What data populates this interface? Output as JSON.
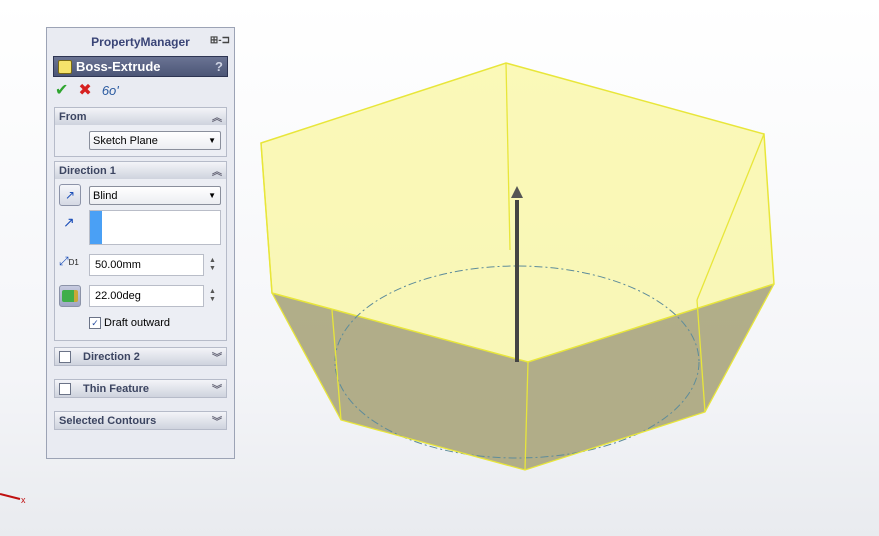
{
  "panel": {
    "title": "PropertyManager",
    "feature_title": "Boss-Extrude",
    "help": "?"
  },
  "actions": {
    "ok": "✔",
    "cancel": "✖",
    "preview": "6o'"
  },
  "from": {
    "header": "From",
    "value": "Sketch Plane"
  },
  "direction1": {
    "header": "Direction 1",
    "end_condition": "Blind",
    "depth": "50.00mm",
    "draft_angle": "22.00deg",
    "draft_outward_label": "Draft outward",
    "draft_outward_checked": true,
    "depth_label": "D1"
  },
  "direction2": {
    "header": "Direction 2"
  },
  "thin": {
    "header": "Thin Feature"
  },
  "contours": {
    "header": "Selected Contours"
  },
  "triad": {
    "x_label": "x"
  },
  "colors": {
    "preview_fill": "#f9f7a0",
    "edge": "#e8e63a",
    "side": "#a9a47c"
  }
}
